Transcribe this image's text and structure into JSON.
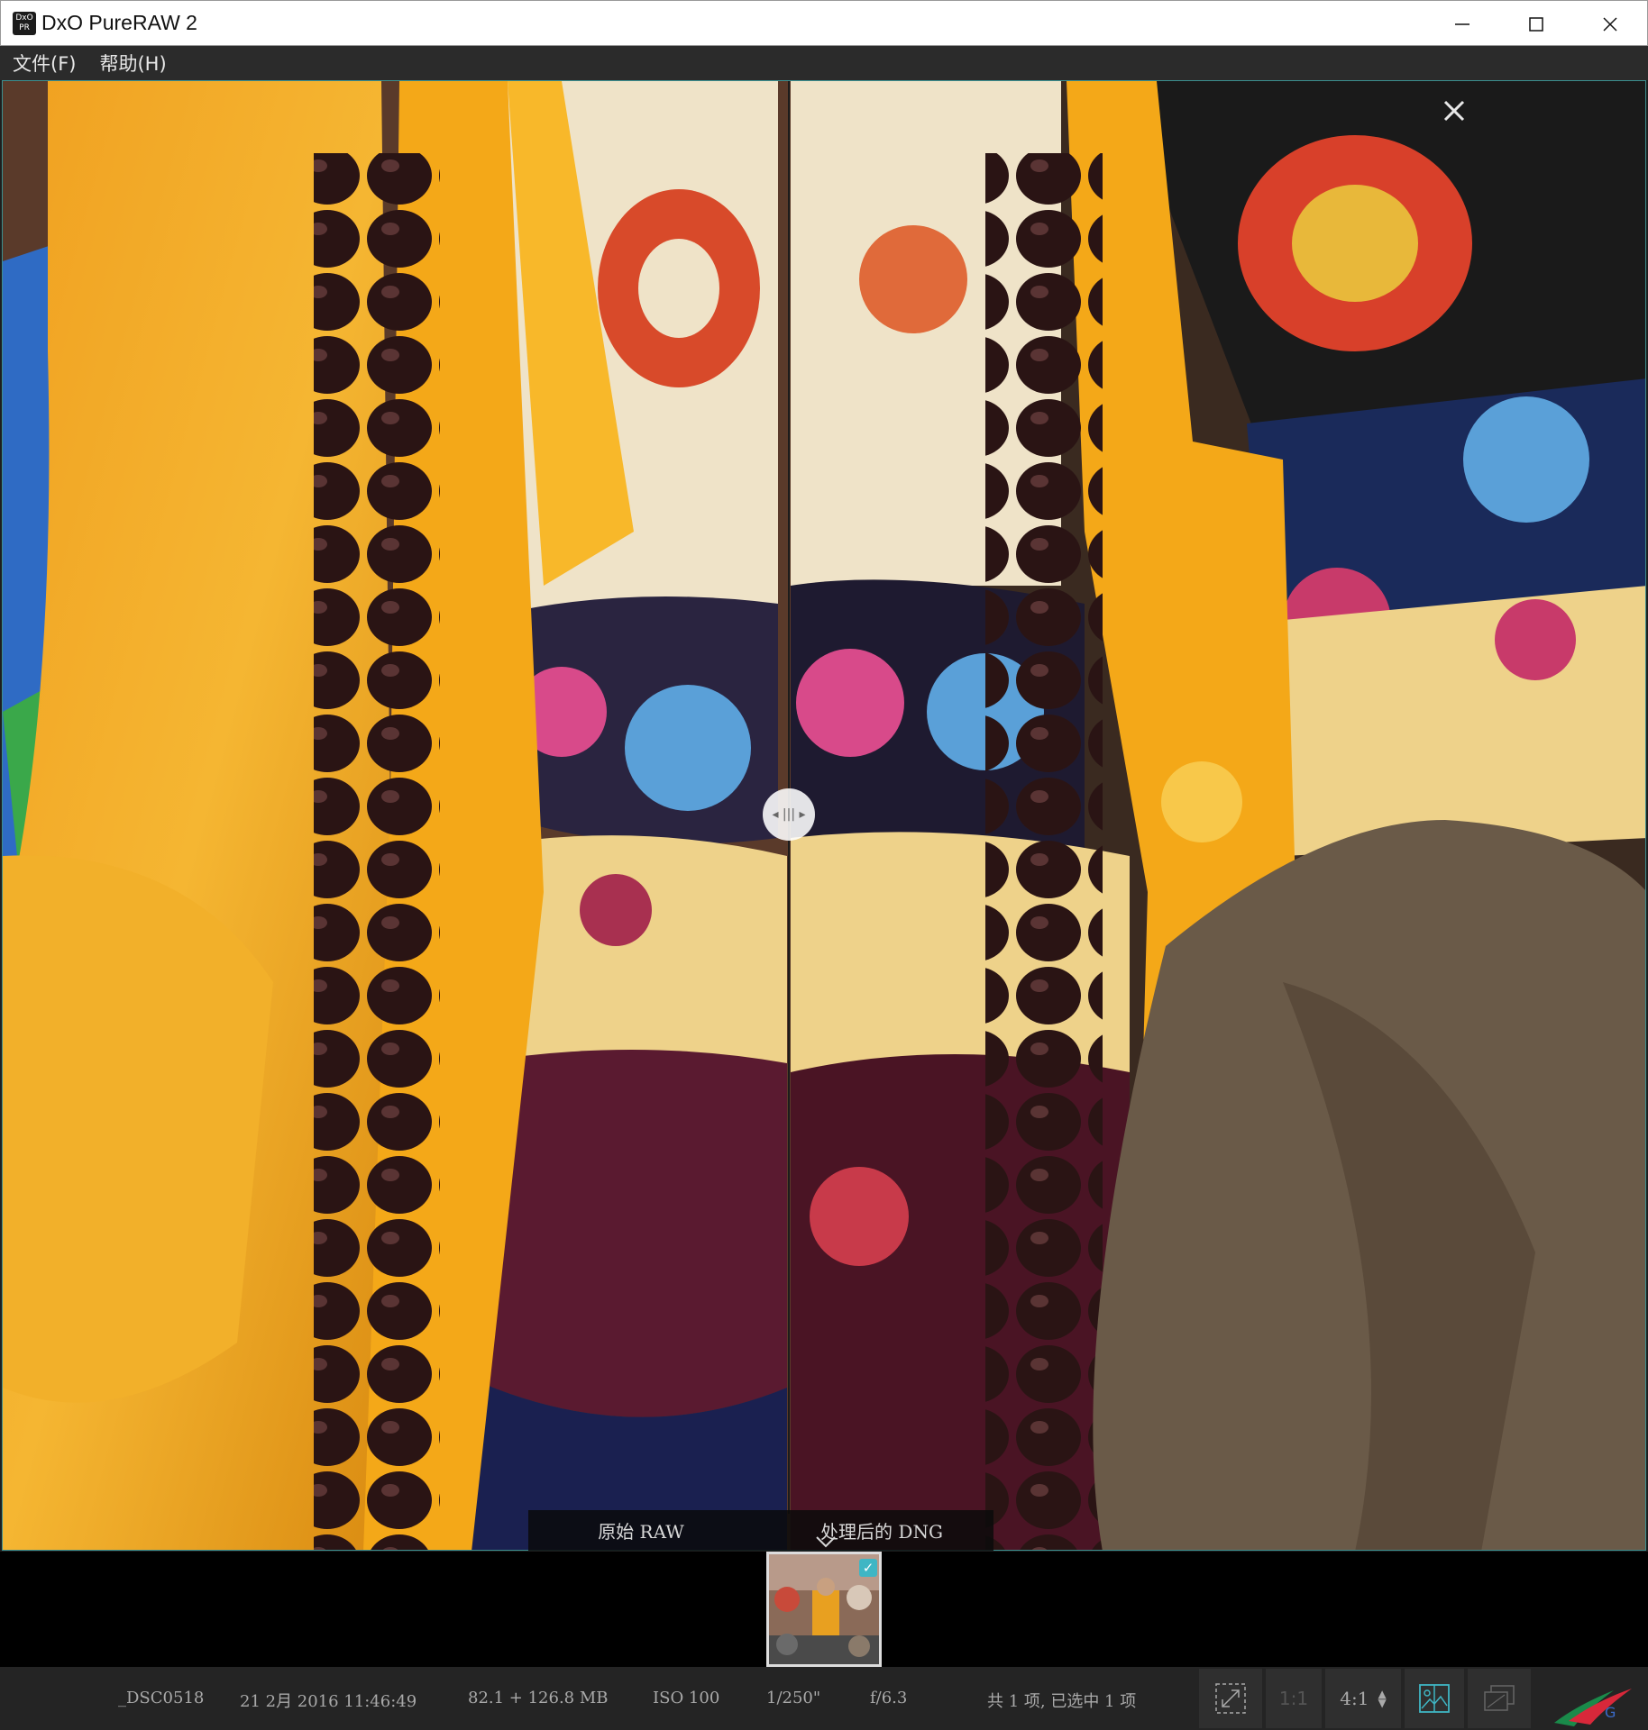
{
  "window": {
    "title": "DxO PureRAW 2",
    "logo_text": "DxO PR",
    "controls": [
      "minimize-icon",
      "maximize-icon",
      "close-icon"
    ]
  },
  "menu": {
    "file": "文件(F)",
    "help": "帮助(H)"
  },
  "viewer": {
    "left_label": "原始 RAW",
    "right_label": "处理后的 DNG",
    "split_handle_icon": "split-drag-handle-icon",
    "close_icon": "close-icon"
  },
  "filmstrip": {
    "selected": true
  },
  "status": {
    "filename": "_DSC0518",
    "datetime": "21 2月 2016 11:46:49",
    "filesize": "82.1 + 126.8 MB",
    "iso": "ISO 100",
    "shutter": "1/250\"",
    "aperture": "f/6.3",
    "selection": "共 1 项, 已选中 1 项",
    "zoom_one_to_one": "1:1",
    "zoom_value": "4:1"
  },
  "colors": {
    "accent": "#3fb6c4",
    "viewer_border": "#3c8f8f",
    "status_bg": "#242424"
  }
}
